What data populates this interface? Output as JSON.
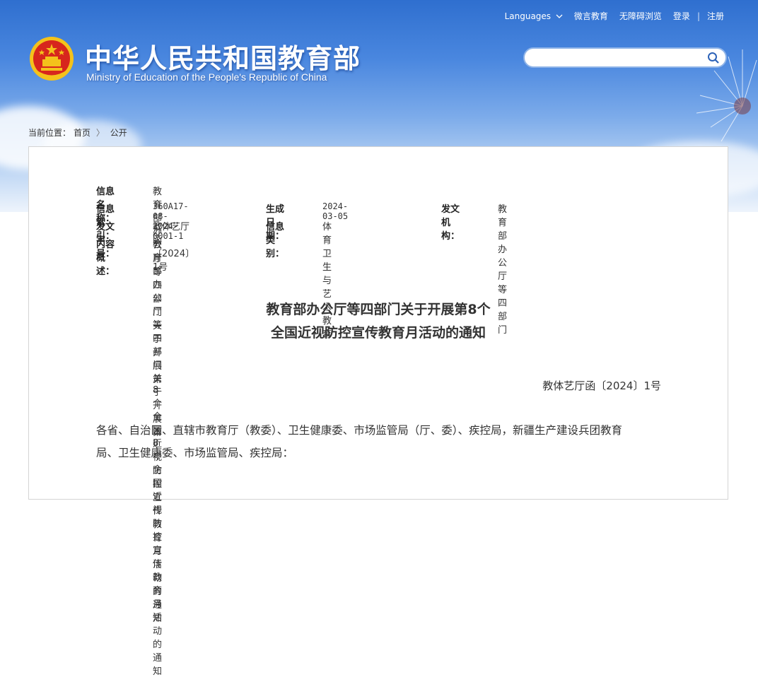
{
  "header": {
    "nav": {
      "languages": "Languages",
      "weixin": "微言教育",
      "accessibility": "无障碍浏览",
      "login": "登录",
      "register": "注册",
      "separator": "|"
    },
    "title": "中华人民共和国教育部",
    "subtitle": "Ministry of Education of the People's Republic of China",
    "search": {
      "placeholder": "",
      "value": ""
    }
  },
  "breadcrumb": {
    "prefix": "当前位置：",
    "home": "首页",
    "arrow": "〉",
    "current": "公开"
  },
  "meta": {
    "name_label": "信息名称：",
    "name_value": "教育部办公厅等四部门关于开展第8个全国近视防控宣传教育月活动的通知",
    "index_label": "信息索引：",
    "index_value": "360A17-08-2024-0001-1",
    "date_label": "生成日期：",
    "date_value": "2024-03-05",
    "org_label": "发文机构：",
    "org_value": "教育部办公厅等四部门",
    "doc_no_label": "发文字号：",
    "doc_no_value": "教体艺厅函〔2024〕1号",
    "category_label": "信息类别：",
    "category_value": "体育卫生与艺术教育",
    "summary_label": "内容概述：",
    "summary_value": "教育部办公厅等四部门关于开展第8个全国近视防控宣传教育月活动的通知"
  },
  "document": {
    "title_line1": "教育部办公厅等四部门关于开展第8个",
    "title_line2": "全国近视防控宣传教育月活动的通知",
    "number": "教体艺厅函〔2024〕1号",
    "body_line1": "各省、自治区、直辖市教育厅（教委）、卫生健康委、市场监管局（厅、委）、疾控局，新疆生产建设兵团教育",
    "body_line2": "局、卫生健康委、市场监管局、疾控局："
  },
  "colors": {
    "sky_top": "#2f6fcf",
    "sky_bottom": "#eef4fc",
    "emblem_red": "#d7261d",
    "emblem_gold": "#f4c21b"
  },
  "icons": {
    "search": "search-icon",
    "chevron": "chevron-down-icon",
    "emblem": "national-emblem-icon"
  }
}
